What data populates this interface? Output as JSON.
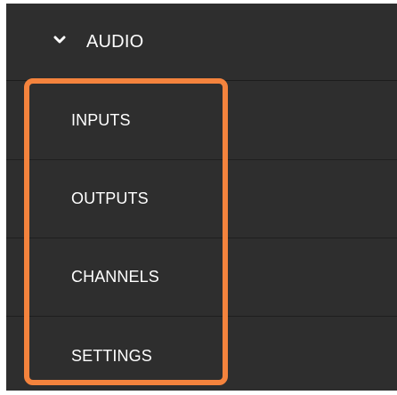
{
  "menu": {
    "section_label": "AUDIO",
    "chevron_icon": "chevron-down-icon",
    "items": [
      {
        "label": "INPUTS"
      },
      {
        "label": "OUTPUTS"
      },
      {
        "label": "CHANNELS"
      },
      {
        "label": "SETTINGS"
      }
    ]
  },
  "colors": {
    "background": "#2e2e2e",
    "text": "#ffffff",
    "highlight": "#f4833d",
    "divider": "#1c1c1c"
  }
}
